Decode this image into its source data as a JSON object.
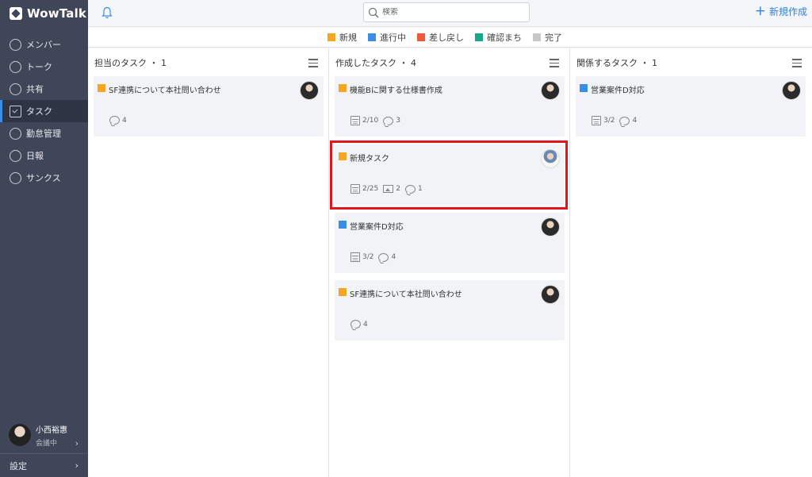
{
  "app": {
    "name": "WowTalk"
  },
  "colors": {
    "new": "#f5a623",
    "in_progress": "#3a8ee6",
    "returned": "#f05a3a",
    "confirming": "#16a888",
    "done": "#c8c8c8",
    "accent": "#2f7fe0"
  },
  "sidebar": {
    "items": [
      {
        "label": "メンバー",
        "icon": "user-icon"
      },
      {
        "label": "トーク",
        "icon": "chat-icon"
      },
      {
        "label": "共有",
        "icon": "share-icon"
      },
      {
        "label": "タスク",
        "icon": "task-icon",
        "active": true
      },
      {
        "label": "勤怠管理",
        "icon": "clock-icon"
      },
      {
        "label": "日報",
        "icon": "report-icon"
      },
      {
        "label": "サンクス",
        "icon": "smile-icon"
      }
    ],
    "user": {
      "name": "小西裕惠",
      "status": "会議中"
    },
    "settings_label": "設定"
  },
  "header": {
    "search_placeholder": "検索",
    "new_label": "新規作成"
  },
  "legend": [
    {
      "label": "新規"
    },
    {
      "label": "進行中"
    },
    {
      "label": "差し戻し"
    },
    {
      "label": "確認まち"
    },
    {
      "label": "完了"
    }
  ],
  "columns": [
    {
      "title": "担当のタスク ・ 1",
      "cards": [
        {
          "title": "SF連携について本社問い合わせ",
          "status": "new",
          "comments": "4"
        }
      ]
    },
    {
      "title": "作成したタスク ・ 4",
      "cards": [
        {
          "title": "機能Bに関する仕様書作成",
          "status": "new",
          "date": "2/10",
          "comments": "3"
        },
        {
          "title": "新規タスク",
          "status": "new",
          "date": "2/25",
          "images": "2",
          "comments": "1"
        },
        {
          "title": "営業案件D対応",
          "status": "in_progress",
          "date": "3/2",
          "comments": "4"
        },
        {
          "title": "SF連携について本社問い合わせ",
          "status": "new",
          "comments": "4"
        }
      ]
    },
    {
      "title": "関係するタスク ・ 1",
      "cards": [
        {
          "title": "営業案件D対応",
          "status": "in_progress",
          "date": "3/2",
          "comments": "4"
        }
      ]
    }
  ]
}
